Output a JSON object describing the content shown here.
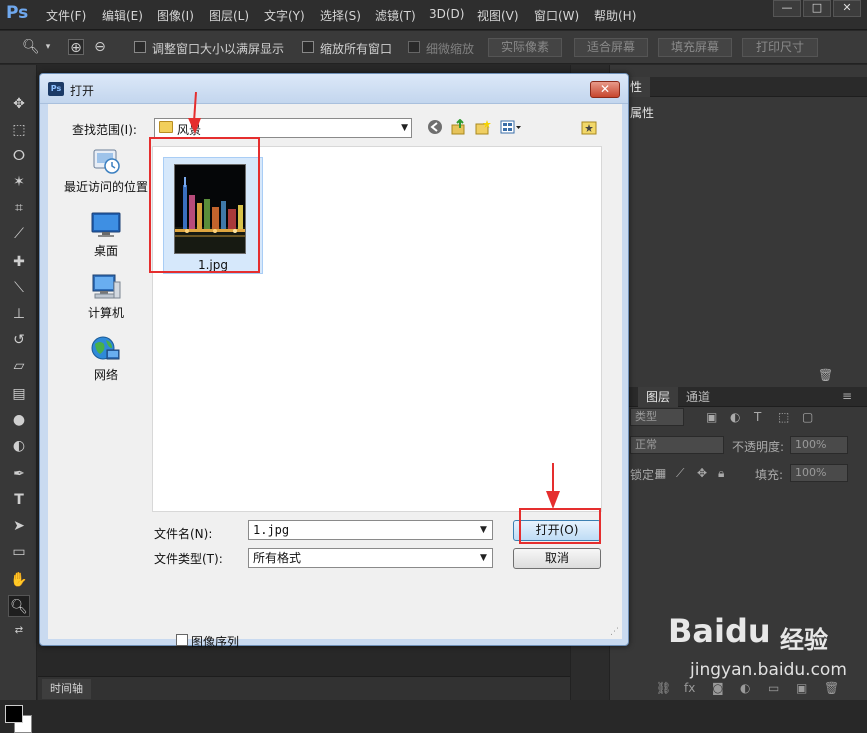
{
  "app": {
    "logo": "Ps",
    "menus": [
      "文件(F)",
      "编辑(E)",
      "图像(I)",
      "图层(L)",
      "文字(Y)",
      "选择(S)",
      "滤镜(T)",
      "3D(D)",
      "视图(V)",
      "窗口(W)",
      "帮助(H)"
    ],
    "window_buttons": [
      "—",
      "□",
      "✕"
    ]
  },
  "options_bar": {
    "resize_windows": "调整窗口大小以满屏显示",
    "zoom_all": "缩放所有窗口",
    "scrubby_zoom": "细微缩放",
    "actual_pixels": "实际像素",
    "fit_screen": "适合屏幕",
    "fill_screen": "填充屏幕",
    "print_size": "打印尺寸"
  },
  "toolbar": {
    "tools": [
      "move-tool",
      "marquee-tool",
      "lasso-tool",
      "magic-wand-tool",
      "crop-tool",
      "eyedropper-tool",
      "healing-brush-tool",
      "brush-tool",
      "clone-stamp-tool",
      "history-brush-tool",
      "eraser-tool",
      "gradient-tool",
      "blur-tool",
      "dodge-tool",
      "pen-tool",
      "type-tool",
      "path-selection-tool",
      "shape-tool",
      "hand-tool",
      "zoom-tool"
    ],
    "active_tool": "zoom-tool",
    "foreground_color": "#000000",
    "background_color": "#ffffff"
  },
  "right_panels": {
    "properties_tab": "属性",
    "properties_title": "属性",
    "layers_tab": "图层",
    "channels_tab": "通道",
    "kind_label": "类型",
    "blend_mode": "正常",
    "opacity_label": "不透明度:",
    "opacity_value": "100%",
    "lock_label": "锁定:",
    "fill_label": "填充:",
    "fill_value": "100%"
  },
  "timeline": {
    "tab": "时间轴"
  },
  "dialog": {
    "title": "打开",
    "close": "✕",
    "look_in_label": "查找范围(I):",
    "look_in_value": "风景",
    "places": [
      {
        "label": "最近访问的位置",
        "icon": "recent-places-icon"
      },
      {
        "label": "桌面",
        "icon": "desktop-icon"
      },
      {
        "label": "计算机",
        "icon": "computer-icon"
      },
      {
        "label": "网络",
        "icon": "network-icon"
      }
    ],
    "files": [
      {
        "name": "1.jpg"
      }
    ],
    "filename_label": "文件名(N):",
    "filename_value": "1.jpg",
    "filetype_label": "文件类型(T):",
    "filetype_value": "所有格式",
    "open_button": "打开(O)",
    "cancel_button": "取消",
    "image_sequence": "图像序列"
  },
  "watermark": {
    "brand": "Baidu",
    "cn": "经验",
    "url": "jingyan.baidu.com"
  },
  "colors": {
    "annotation_red": "#e52e2e",
    "dialog_frame": "#c9daf0",
    "selection": "#d6e8fb"
  }
}
